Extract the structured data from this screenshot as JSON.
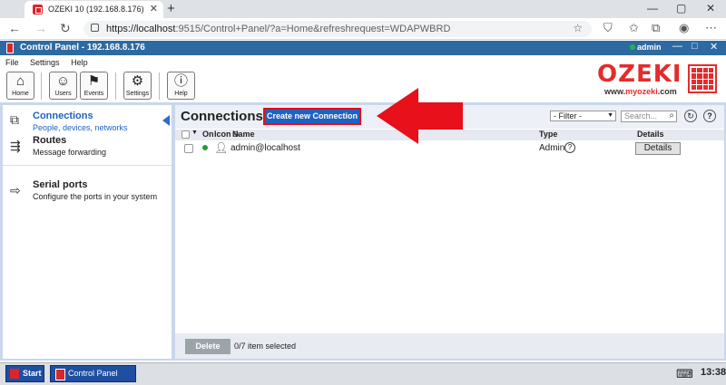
{
  "browser": {
    "tab_title": "OZEKI 10 (192.168.8.176)",
    "url_host": "https://localhost",
    "url_rest": ":9515/Control+Panel/?a=Home&refreshrequest=WDAPWBRD"
  },
  "app": {
    "title": "Control Panel - 192.168.8.176",
    "user": "admin",
    "menu": [
      "File",
      "Settings",
      "Help"
    ],
    "toolbar": [
      {
        "label": "Home",
        "icon": "home-icon"
      },
      {
        "label": "Users",
        "icon": "user-icon"
      },
      {
        "label": "Events",
        "icon": "flag-icon"
      },
      {
        "label": "Settings",
        "icon": "gear-icon"
      },
      {
        "label": "Help",
        "icon": "info-icon"
      }
    ],
    "brand": {
      "logo": "OZEKI",
      "url_prefix": "www.",
      "url_main": "myozeki",
      "url_suffix": ".com"
    }
  },
  "sidebar": {
    "items": [
      {
        "title": "Connections",
        "subtitle": "People, devices, networks",
        "icon": "connections-icon"
      },
      {
        "title": "Routes",
        "subtitle": "Message forwarding",
        "icon": "routes-icon"
      },
      {
        "title": "Serial ports",
        "subtitle": "Configure the ports in your system",
        "icon": "serial-port-icon"
      }
    ]
  },
  "main": {
    "title": "Connections",
    "create_button": "Create new Connection",
    "filter": "- Filter -",
    "search_placeholder": "Search...",
    "columns": {
      "on": "On",
      "icon": "Icon",
      "name": "Name",
      "type": "Type",
      "details": "Details"
    },
    "rows": [
      {
        "name": "admin@localhost",
        "type": "Admin",
        "details": "Details",
        "status": "online"
      }
    ],
    "delete_button": "Delete",
    "selected_text": "0/7 item selected"
  },
  "taskbar": {
    "start": "Start",
    "window": "Control Panel",
    "clock": "13:38"
  },
  "colors": {
    "accent": "#1f62c2",
    "brand_red": "#e52b2b",
    "header_blue": "#2d6aa2",
    "highlight": "#e0101a"
  }
}
